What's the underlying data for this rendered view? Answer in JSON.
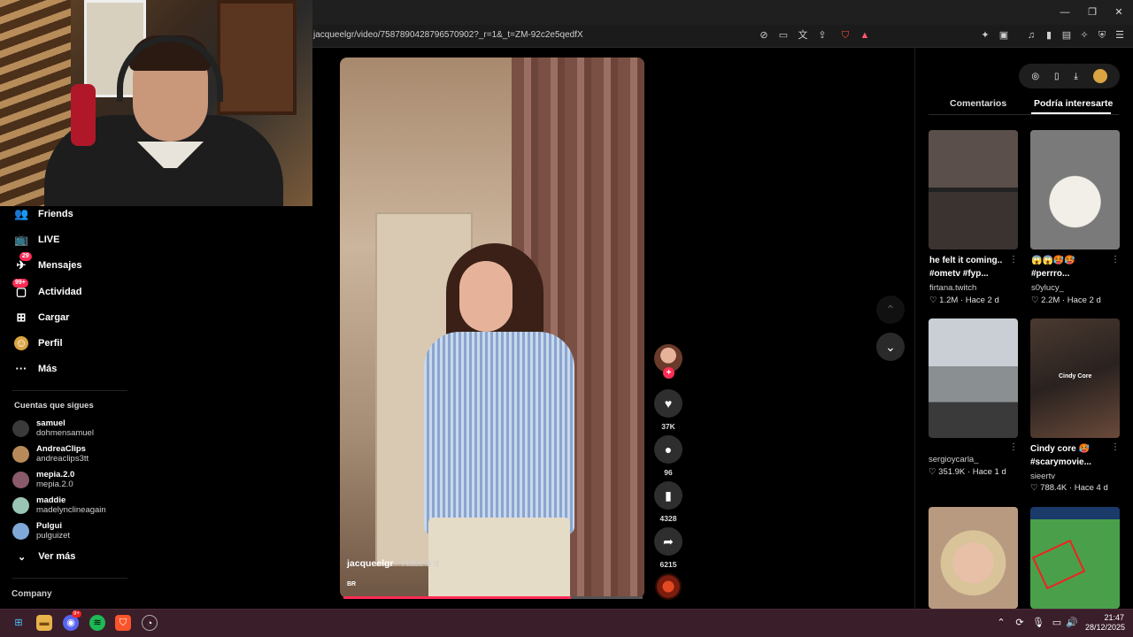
{
  "browser": {
    "url": "jacqueelgr/video/7587890428796570902?_r=1&_t=ZM-92c2e5qedfX",
    "window_controls": {
      "minimize": "—",
      "restore": "❐",
      "close": "✕"
    }
  },
  "sidebar": {
    "items": [
      {
        "label": "Friends",
        "icon": "friends-icon"
      },
      {
        "label": "LIVE",
        "icon": "live-icon"
      },
      {
        "label": "Mensajes",
        "icon": "messages-icon",
        "badge": "29"
      },
      {
        "label": "Actividad",
        "icon": "activity-icon",
        "badge": "99+"
      },
      {
        "label": "Cargar",
        "icon": "upload-icon"
      },
      {
        "label": "Perfil",
        "icon": "profile-icon"
      },
      {
        "label": "Más",
        "icon": "more-icon"
      }
    ],
    "following_title": "Cuentas que sigues",
    "following": [
      {
        "name": "samuel",
        "handle": "dohmensamuel",
        "color": "#3a3a3a"
      },
      {
        "name": "AndreaClips",
        "handle": "andreaclips3tt",
        "color": "#b88a5a"
      },
      {
        "name": "mepia.2.0",
        "handle": "mepia.2.0",
        "color": "#8a5a6a"
      },
      {
        "name": "maddie",
        "handle": "madelynclineagain",
        "color": "#9ac5b5"
      },
      {
        "name": "Pulgui",
        "handle": "pulguizet",
        "color": "#7fa8d8"
      }
    ],
    "see_more": "Ver más",
    "company": "Company"
  },
  "video": {
    "author": "jacqueelgr",
    "time": "· Hace 3 d",
    "region": "BR",
    "progress": 0.76,
    "likes": "37K",
    "comments": "96",
    "saves": "4328",
    "shares": "6215"
  },
  "panel": {
    "tabs": [
      "Comentarios",
      "Podría interesarte"
    ],
    "active_tab": "Podría interesarte",
    "recommendations": [
      {
        "title": "he felt it coming.. #ometv #fyp...",
        "author": "firtana.twitch",
        "likes": "1.2M",
        "time": "Hace 2 d"
      },
      {
        "title": "😱😱🥵🥵 #perrro...",
        "author": "s0ylucy_",
        "likes": "2.2M",
        "time": "Hace 2 d"
      },
      {
        "title": "",
        "author": "sergioycarla_",
        "likes": "351.9K",
        "time": "Hace 1 d"
      },
      {
        "title": "Cindy core 🥵 #scarymovie...",
        "author": "sieertv",
        "likes": "788.4K",
        "time": "Hace 4 d",
        "overlay": "Cindy Core"
      },
      {
        "title": "",
        "author": "",
        "likes": "",
        "time": ""
      },
      {
        "title": "",
        "author": "",
        "likes": "",
        "time": ""
      }
    ]
  },
  "taskbar": {
    "time": "21:47",
    "date": "28/12/2025",
    "discord_badge": "9+"
  }
}
